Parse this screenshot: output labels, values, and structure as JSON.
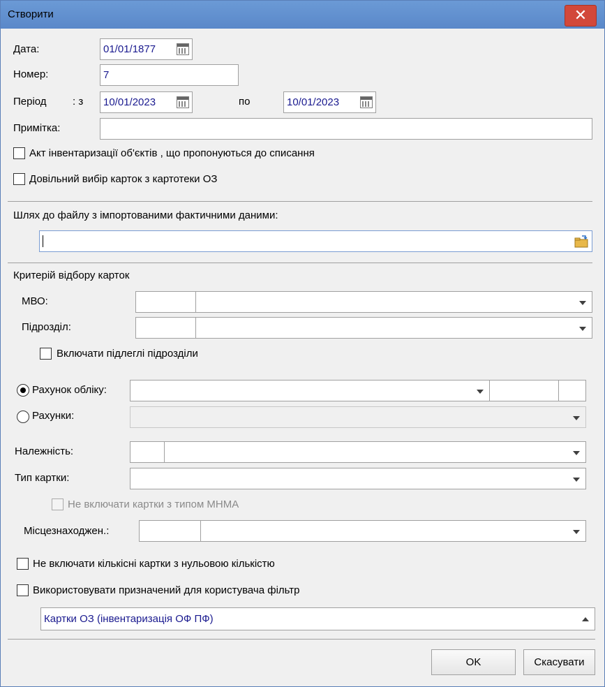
{
  "window": {
    "title": "Створити",
    "close_glyph": "✕"
  },
  "fields": {
    "date_label": "Дата:",
    "date_value": "01/01/1877",
    "number_label": "Номер:",
    "number_value": "7",
    "period_label": "Період",
    "period_from_label": ": з",
    "period_from_value": "10/01/2023",
    "period_to_label": "по",
    "period_to_value": "10/01/2023",
    "note_label": "Примітка:",
    "note_value": ""
  },
  "checkboxes": {
    "act_writeoff": "Акт інвентаризації об'єктів , що пропонуються до списання",
    "arbitrary_choice": "Довільний вибір карток з картотеки ОЗ"
  },
  "import": {
    "label": "Шлях до файлу з імпортованими фактичними даними:",
    "value": ""
  },
  "criteria": {
    "title": "Критерій відбору карток",
    "mvo_label": "МВО:",
    "subdivision_label": "Підрозділ:",
    "include_sub_label": "Включати підлеглі підрозділи",
    "account_label": "Рахунок обліку:",
    "accounts_label": "Рахунки:",
    "belonging_label": "Належність:",
    "card_type_label": "Тип картки:",
    "exclude_mnma_label": "Не включати картки з типом МНМА",
    "location_label": "Місцезнаходжен.:",
    "exclude_zero_label": "Не включати кількісні картки з нульовою кількістю",
    "use_filter_label": "Використовувати призначений для користувача фільтр",
    "filter_value": "Картки ОЗ (інвентаризація ОФ ПФ)"
  },
  "buttons": {
    "ok": "OK",
    "cancel": "Скасувати"
  }
}
